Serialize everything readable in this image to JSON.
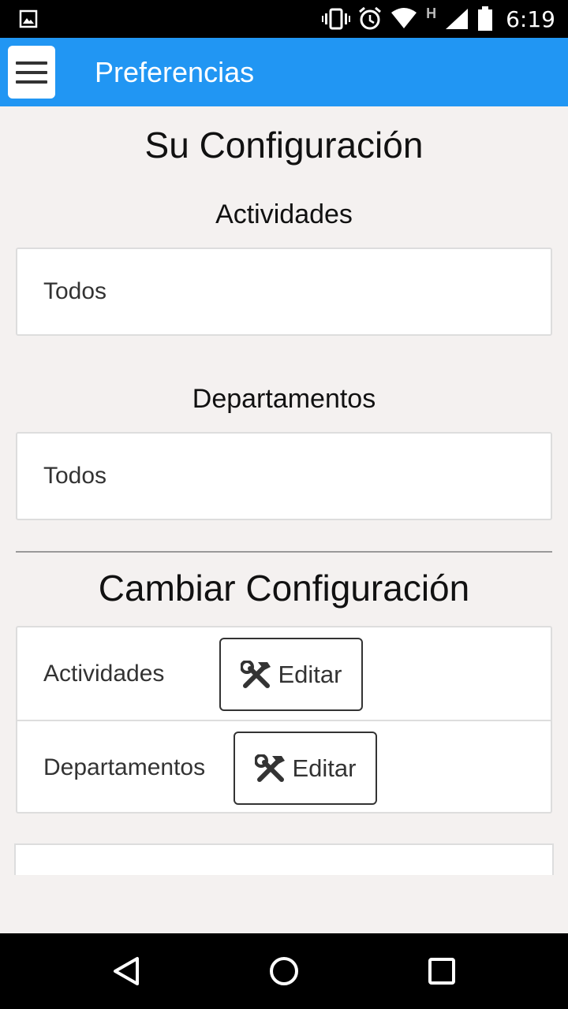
{
  "status_bar": {
    "time": "6:19",
    "network_label": "H",
    "icons": [
      "gallery-icon",
      "vibrate-icon",
      "alarm-icon",
      "wifi-icon",
      "signal-icon",
      "battery-icon"
    ]
  },
  "app_bar": {
    "title": "Preferencias",
    "menu_icon": "hamburger-menu-icon",
    "color": "#2196f3"
  },
  "current_config": {
    "title": "Su Configuración",
    "activities_label": "Actividades",
    "activities_value": "Todos",
    "departments_label": "Departamentos",
    "departments_value": "Todos"
  },
  "change_config": {
    "title": "Cambiar Configuración",
    "rows": [
      {
        "label": "Actividades",
        "button_label": "Editar",
        "icon": "tools-icon"
      },
      {
        "label": "Departamentos",
        "button_label": "Editar",
        "icon": "tools-icon"
      }
    ]
  },
  "nav_bar": {
    "icons": [
      "back-icon",
      "home-icon",
      "recents-icon"
    ]
  }
}
